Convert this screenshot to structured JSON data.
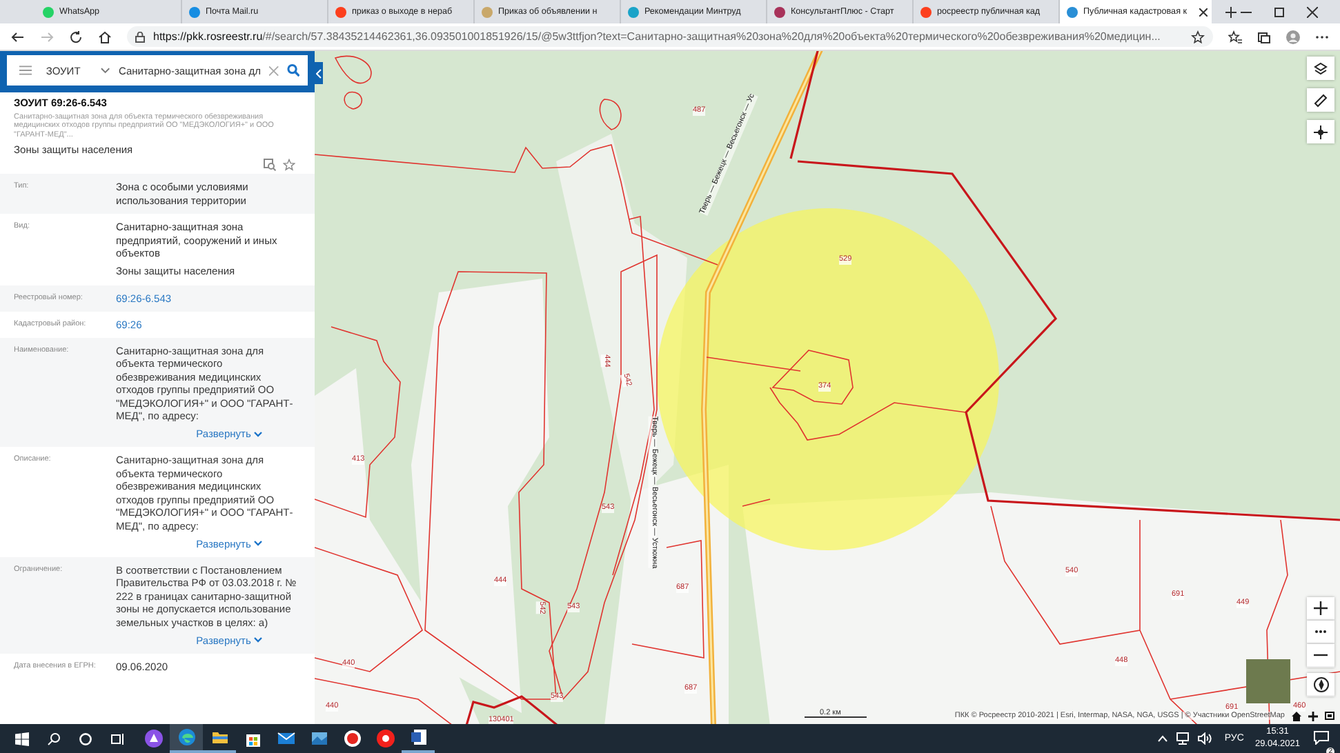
{
  "browser": {
    "tabs": [
      {
        "title": "WhatsApp",
        "color": "#25d366",
        "selected": false
      },
      {
        "title": "Почта Mail.ru",
        "color": "#168de2",
        "selected": false
      },
      {
        "title": "приказ о выходе в нераб",
        "color": "#fc3f1d",
        "selected": false
      },
      {
        "title": "Приказ об объявлении н",
        "color": "#c9a86a",
        "selected": false
      },
      {
        "title": "Рекомендации Минтруд",
        "color": "#1aa3c8",
        "selected": false
      },
      {
        "title": "КонсультантПлюс - Старт",
        "color": "#a8325a",
        "selected": false
      },
      {
        "title": "росреестр публичная кад",
        "color": "#fc3f1d",
        "selected": false
      },
      {
        "title": "Публичная кадастровая к",
        "color": "#2a8fd6",
        "selected": true
      }
    ],
    "url_host": "https://pkk.rosreestr.ru",
    "url_rest": "/#/search/57.38435214462361,36.093501001851926/15/@5w3ttfjon?text=Санитарно-защитная%20зона%20для%20объекта%20термического%20обезвреживания%20медицин..."
  },
  "panel": {
    "search": {
      "layer": "ЗОУИТ",
      "value": "Санитарно-защитная зона дл"
    },
    "title": "ЗОУИТ 69:26-6.543",
    "subtitle": "Санитарно-защитная зона для объекта термического обезвреживания медицинских отходов группы предприятий ОО \"МЕДЭКОЛОГИЯ+\" и ООО \"ГАРАНТ-МЕД\"...",
    "category": "Зоны защиты населения",
    "fields": [
      {
        "label": "Тип:",
        "kind": "text",
        "values": [
          "Зона с особыми условиями использования территории"
        ]
      },
      {
        "label": "Вид:",
        "kind": "text",
        "values": [
          "Санитарно-защитная зона предприятий, сооружений и иных объектов",
          "Зоны защиты населения"
        ]
      },
      {
        "label": "Реестровый номер:",
        "kind": "link",
        "values": [
          "69:26-6.543"
        ]
      },
      {
        "label": "Кадастровый район:",
        "kind": "link",
        "values": [
          "69:26"
        ]
      },
      {
        "label": "Наименование:",
        "kind": "expandable",
        "values": [
          "Санитарно-защитная зона для объекта термического обезвреживания медицинских отходов группы предприятий ОО \"МЕДЭКОЛОГИЯ+\" и ООО \"ГАРАНТ-МЕД\", по адресу:"
        ],
        "expand": "Развернуть"
      },
      {
        "label": "Описание:",
        "kind": "expandable",
        "values": [
          "Санитарно-защитная зона для объекта термического обезвреживания медицинских отходов группы предприятий ОО \"МЕДЭКОЛОГИЯ+\" и ООО \"ГАРАНТ-МЕД\", по адресу:"
        ],
        "expand": "Развернуть"
      },
      {
        "label": "Ограничение:",
        "kind": "expandable",
        "values": [
          "В соответствии с Постановлением Правительства РФ от 03.03.2018 г. № 222 в границах санитарно-защитной зоны не допускается использование земельных участков в целях: а)"
        ],
        "expand": "Развернуть"
      },
      {
        "label": "Дата внесения в ЕГРН:",
        "kind": "text",
        "values": [
          "09.06.2020"
        ]
      }
    ]
  },
  "map": {
    "labels": [
      "487",
      "529",
      "374",
      "444",
      "542",
      "413",
      "543",
      "444",
      "543",
      "542",
      "687",
      "440",
      "440",
      "543",
      "687",
      "130401",
      "540",
      "691",
      "449",
      "448",
      "691",
      "460"
    ],
    "roads": [
      "Тверь — Бежецк — Весьегонск — Ус",
      "Тверь — Бежецк — Весьегонск — Устюжна"
    ],
    "scale": "0.2 км",
    "attribution": "ПКК © Росреестр 2010-2021 | Esri, Intermap, NASA, NGA, USGS | © Участники OpenStreetMap"
  },
  "taskbar": {
    "apps": [
      {
        "kind": "assistant",
        "selected": false,
        "running": false
      },
      {
        "kind": "edge",
        "selected": true,
        "running": true
      },
      {
        "kind": "explorer",
        "selected": false,
        "running": true
      },
      {
        "kind": "store",
        "selected": false,
        "running": false
      },
      {
        "kind": "mail",
        "selected": false,
        "running": false
      },
      {
        "kind": "photos",
        "selected": false,
        "running": false
      },
      {
        "kind": "yabrowser",
        "selected": false,
        "running": false
      },
      {
        "kind": "yandex",
        "selected": false,
        "running": false
      },
      {
        "kind": "word",
        "selected": false,
        "running": true
      }
    ],
    "language": "РУС",
    "time": "15:31",
    "date": "29.04.2021",
    "notifications": "2"
  }
}
